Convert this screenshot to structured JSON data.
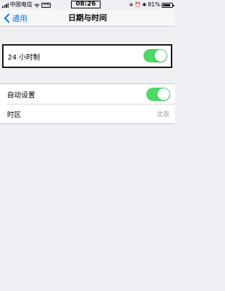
{
  "status_bar": {
    "carrier": "中国电信",
    "vpn": "VPN",
    "time": "08:26",
    "battery": "81%",
    "battery_level": 0.81
  },
  "nav": {
    "back_label": "通用",
    "title": "日期与时间"
  },
  "settings": {
    "hour24": {
      "label": "24 小时制",
      "on": true
    },
    "auto": {
      "label": "自动设置",
      "on": true
    },
    "timezone": {
      "label": "时区",
      "value": "北京"
    }
  },
  "colors": {
    "accent": "#007aff",
    "toggle_on": "#4cd964",
    "background": "#efeff4"
  }
}
